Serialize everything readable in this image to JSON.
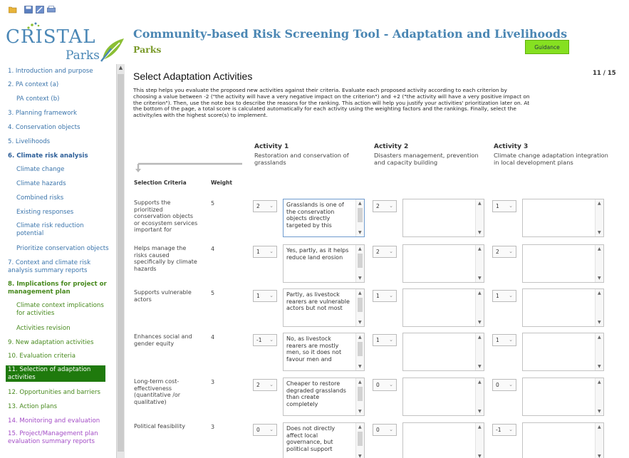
{
  "toolbar": {
    "icons": [
      "folder-open-icon",
      "save-icon",
      "edit-icon",
      "print-icon"
    ]
  },
  "logo": {
    "word1": "CRISTAL",
    "word2": "Parks"
  },
  "header": {
    "title": "Community-based Risk Screening Tool - Adaptation and Livelihoods",
    "subtitle": "Parks",
    "guidance_label": "Guidance"
  },
  "sidebar": {
    "items": [
      {
        "label": "1. Introduction and purpose"
      },
      {
        "label": "2. PA context (a)"
      },
      {
        "label": "PA context (b)"
      },
      {
        "label": "3. Planning framework"
      },
      {
        "label": "4. Conservation objects"
      },
      {
        "label": "5. Livelihoods"
      },
      {
        "label": "6. Climate risk analysis"
      },
      {
        "label": "Climate change"
      },
      {
        "label": "Climate hazards"
      },
      {
        "label": "Combined risks"
      },
      {
        "label": "Existing responses"
      },
      {
        "label": "Climate risk reduction potential"
      },
      {
        "label": "Prioritize conservation objects"
      },
      {
        "label": "7. Context and climate risk analysis summary reports"
      },
      {
        "label": "8. Implications for project or management plan"
      },
      {
        "label": "Climate context implications for activities"
      },
      {
        "label": "Activities revision"
      },
      {
        "label": "9. New adaptation activities"
      },
      {
        "label": "10. Evaluation criteria"
      },
      {
        "label": "11. Selection of adaptation activities"
      },
      {
        "label": "12. Opportunities and barriers"
      },
      {
        "label": "13. Action plans"
      },
      {
        "label": "14. Monitoring and evaluation"
      },
      {
        "label": "15. Project/Management plan evaluation summary reports"
      }
    ]
  },
  "main": {
    "heading": "Select Adaptation Activities",
    "page_counter": "11 / 15",
    "intro": "This step helps you evaluate the proposed new activities against their criteria. Evaluate each proposed activity according to each criterion by choosing a value between -2 (\"the activity will have a very negative impact on the criterion\") and +2 (\"the activity will have a very positive impact on the criterion\"). Then, use the note box to describe the reasons for the ranking. This action will help you justify your activities' prioritization later on. At the bottom of the page, a total score is calculated automatically for each activity using the weighting factors and the rankings. Finally, select the activity/ies with the highest score(s) to implement.",
    "col_headers": {
      "criteria": "Selection Criteria",
      "weight": "Weight"
    },
    "activities": [
      {
        "title": "Activity 1",
        "desc": "Restoration and conservation of grasslands"
      },
      {
        "title": "Activity 2",
        "desc": "Disasters management, prevention and capacity building"
      },
      {
        "title": "Activity 3",
        "desc": "Climate change adaptation integration in local development plans"
      }
    ],
    "rows": [
      {
        "criterion": "Supports the prioritized conservation objects or ecosystem services important for",
        "weight": "5",
        "ratings": [
          "2",
          "2",
          "1"
        ],
        "notes": [
          "Grasslands is one of the conservation objects directly targeted by this",
          "",
          ""
        ]
      },
      {
        "criterion": "Helps manage the risks caused specifically by climate hazards",
        "weight": "4",
        "ratings": [
          "1",
          "2",
          "2"
        ],
        "notes": [
          "Yes, partly, as it helps reduce land erosion",
          "",
          ""
        ]
      },
      {
        "criterion": "Supports vulnerable actors",
        "weight": "5",
        "ratings": [
          "1",
          "1",
          "1"
        ],
        "notes": [
          "Partly, as livestock rearers are vulnerable actors but not most",
          "",
          ""
        ]
      },
      {
        "criterion": "Enhances social and gender equity",
        "weight": "4",
        "ratings": [
          "-1",
          "1",
          "1"
        ],
        "notes": [
          "No, as livestock rearers are mostly men, so it does not favour men and",
          "",
          ""
        ]
      },
      {
        "criterion": "Long-term cost-effectiveness (quantitative /or qualitative)",
        "weight": "3",
        "ratings": [
          "2",
          "0",
          "0"
        ],
        "notes": [
          "Cheaper to restore degraded grasslands than create completely",
          "",
          ""
        ]
      },
      {
        "criterion": "Political feasibility",
        "weight": "3",
        "ratings": [
          "0",
          "0",
          "-1"
        ],
        "notes": [
          "Does not directly affect local governance, but political support",
          "",
          ""
        ]
      }
    ]
  },
  "colors": {
    "brand_blue": "#4a86b3",
    "accent_green": "#86e021",
    "active_nav": "#1f7a0d",
    "nav_purple": "#a34cc6"
  }
}
